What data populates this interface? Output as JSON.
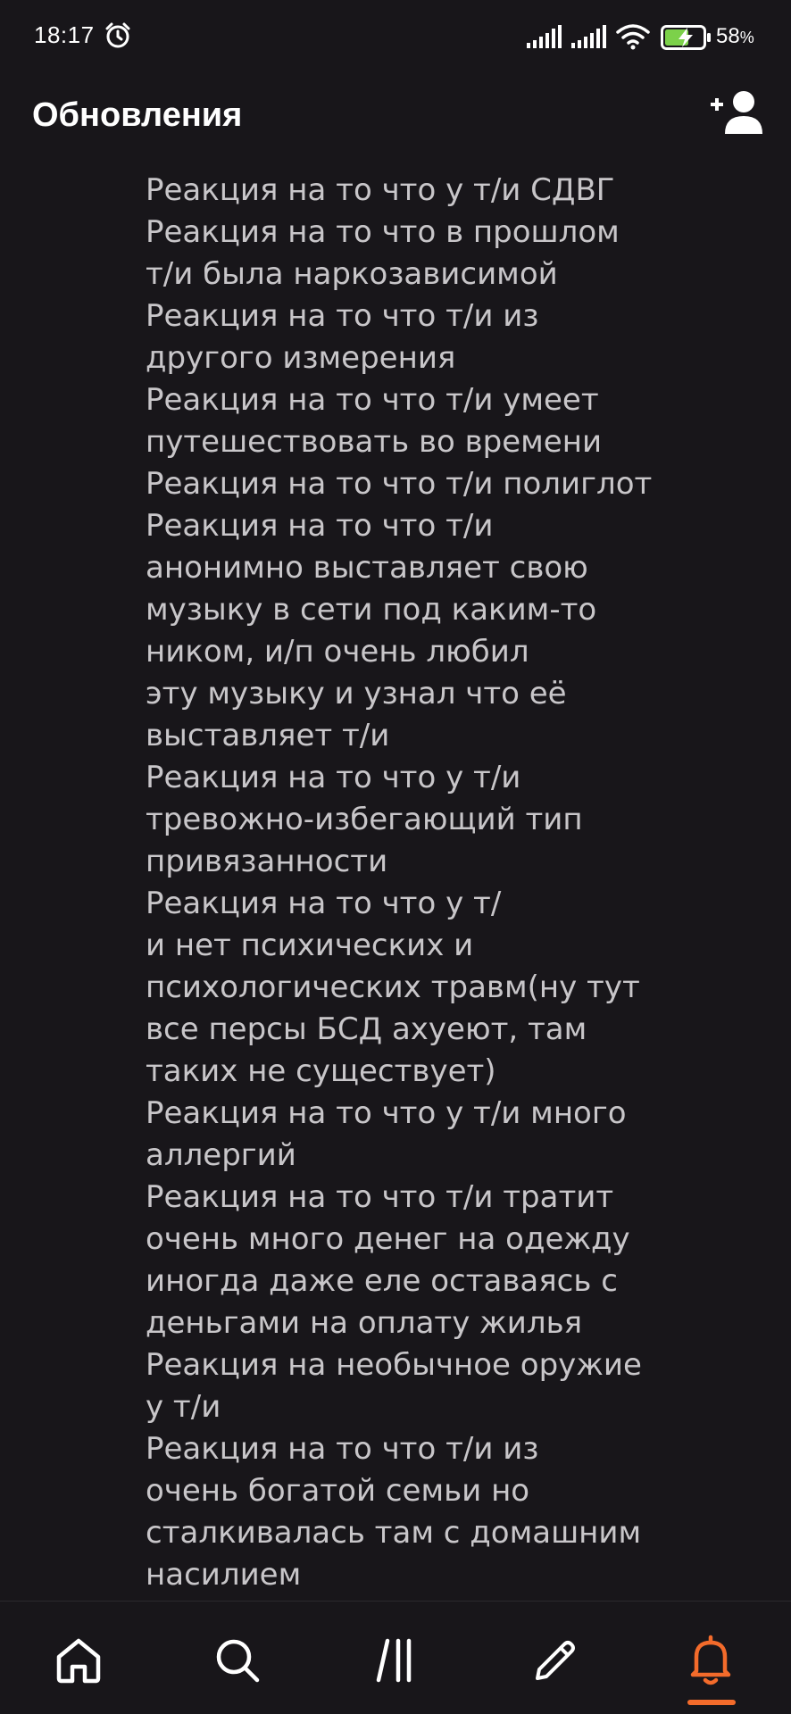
{
  "status_bar": {
    "time": "18:17",
    "battery_percent": "58",
    "battery_percent_sign": "%"
  },
  "header": {
    "title": "Обновления"
  },
  "content": {
    "lines": [
      "Реакция на то что у т/и СДВГ",
      "Реакция на то что в прошлом",
      "т/и была наркозависимой",
      "Реакция на то что т/и из",
      "другого измерения",
      "Реакция на то что т/и умеет",
      "путешествовать во времени",
      "Реакция на то что т/и полиглот",
      "Реакция на то что т/и",
      "анонимно выставляет свою",
      "музыку в сети под каким-то",
      "ником, и/п очень любил",
      "эту музыку и узнал что её",
      "выставляет т/и",
      "Реакция на то что у т/и",
      "тревожно-избегающий тип",
      "привязанности",
      "Реакция на то что у т/",
      "и нет психических и",
      "психологических травм(ну тут",
      "все персы БСД ахуеют, там",
      "таких не существует)",
      "Реакция на то что у т/и много",
      "аллергий",
      "Реакция на то что т/и тратит",
      "очень много денег на одежду",
      "иногда даже еле оставаясь с",
      "деньгами на оплату жилья",
      "Реакция на необычное оружие",
      "у т/и",
      "Реакция на то что т/и из",
      "очень богатой семьи но",
      "сталкивалась там с домашним",
      "насилием"
    ]
  },
  "bottom_nav": {
    "items": [
      "home-icon",
      "search-icon",
      "library-icon",
      "pencil-icon",
      "bell-icon"
    ],
    "active": "notifications"
  },
  "colors": {
    "background": "#18161a",
    "text": "#c8c6c9",
    "accent": "#f36b2b"
  }
}
